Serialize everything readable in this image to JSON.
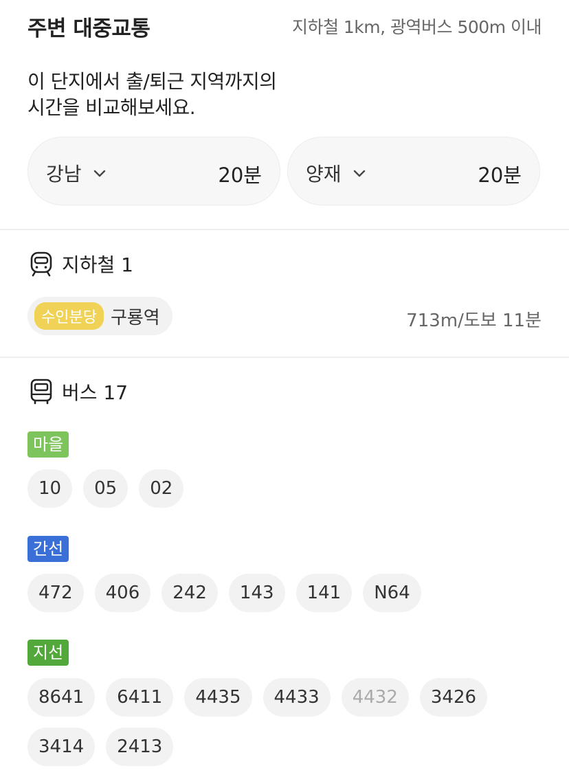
{
  "header": {
    "title": "주변 대중교통",
    "subtitle": "지하철 1km, 광역버스 500m 이내"
  },
  "intro": {
    "line1": "이 단지에서 출/퇴근 지역까지의",
    "line2": "시간을 비교해보세요."
  },
  "commutes": [
    {
      "destination": "강남",
      "time": "20분"
    },
    {
      "destination": "양재",
      "time": "20분"
    }
  ],
  "subway": {
    "title": "지하철 1",
    "icon": "subway-icon",
    "station": {
      "line": "수인분당",
      "line_color": "#f0d356",
      "name": "구룡역",
      "distance": "713m/도보 11분"
    }
  },
  "bus": {
    "title": "버스 17",
    "icon": "bus-icon",
    "categories": [
      {
        "label": "마을",
        "color": "#7cc45b",
        "routes": [
          "10",
          "05",
          "02"
        ]
      },
      {
        "label": "간선",
        "color": "#3a6fd8",
        "routes": [
          "472",
          "406",
          "242",
          "143",
          "141",
          "N64"
        ]
      },
      {
        "label": "지선",
        "color": "#52a83a",
        "routes": [
          "8641",
          "6411",
          "4435",
          "4433",
          "4432",
          "3426",
          "3414",
          "2413"
        ]
      }
    ]
  }
}
